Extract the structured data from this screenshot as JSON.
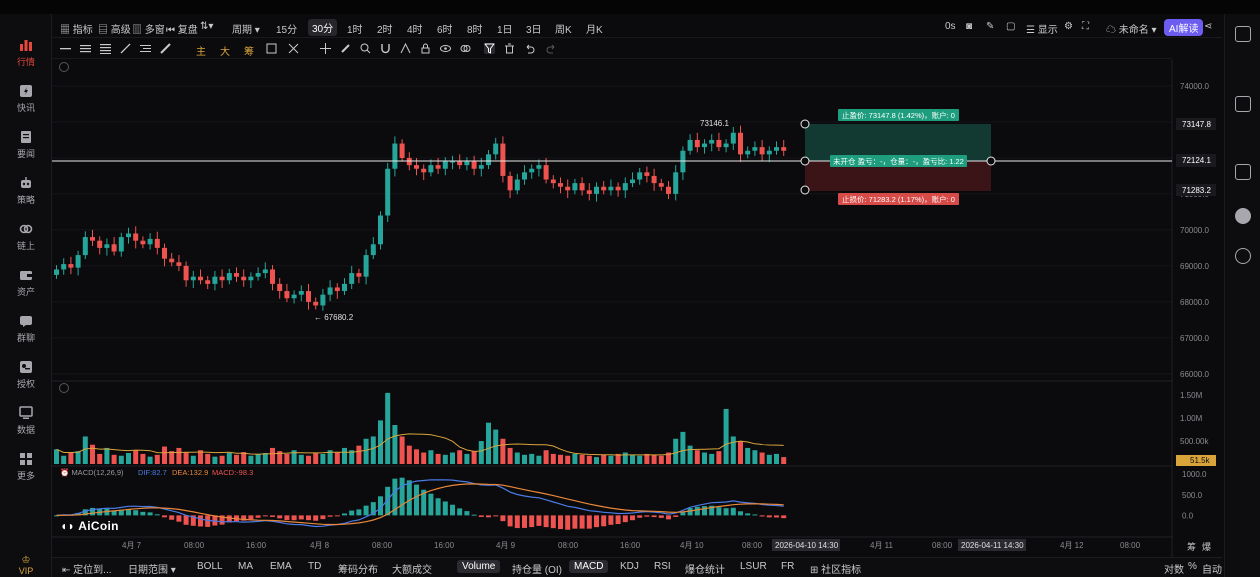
{
  "toolbar_top": {
    "indicators": "指标",
    "advanced": "高级",
    "multi": "多窗",
    "replay": "复盘",
    "period": "周期",
    "intervals": [
      "15分",
      "30分",
      "1时",
      "2时",
      "4时",
      "6时",
      "8时",
      "1日",
      "3日",
      "周K",
      "月K"
    ],
    "active_interval": "30分",
    "latency": "0s",
    "display": "显示",
    "layout_name": "未命名",
    "ai_label": "AI解读"
  },
  "toolbar_draw": {
    "main": "主",
    "big": "大",
    "chip": "筹"
  },
  "left_nav": [
    "行情",
    "快讯",
    "要闻",
    "策略",
    "链上",
    "资产",
    "群聊",
    "授权",
    "数据",
    "更多"
  ],
  "vip": "VIP",
  "price_axis": [
    "74000.0",
    "73000.0",
    "72000.0",
    "71000.0",
    "70000.0",
    "69000.0",
    "68000.0",
    "67000.0",
    "66000.0"
  ],
  "price_tags": {
    "take_profit": "73147.8",
    "current": "72124.1",
    "stop_loss": "71283.2"
  },
  "annotations": {
    "high": "73146.1",
    "low": "← 67680.2"
  },
  "order_box": {
    "tp_text": "止盈价: 73147.8 (1.42%)，账户: 0",
    "pnl_text": "未开仓 盈亏：-，仓量：-，盈亏比: 1.22",
    "sl_text": "止损价: 71283.2 (1.17%)，账户: 0"
  },
  "volume_axis": [
    "1.50M",
    "1.00M",
    "500.00k"
  ],
  "volume_tag": "51.5k",
  "macd_label": "MACD(12,26,9)",
  "macd_values": {
    "dif": "DIF:82.7",
    "dea": "DEA:132.9",
    "macd": "MACD:-98.3"
  },
  "macd_axis": [
    "1000.0",
    "500.0",
    "0.0"
  ],
  "time_axis": [
    "4月 7",
    "08:00",
    "16:00",
    "4月 8",
    "08:00",
    "16:00",
    "4月 9",
    "08:00",
    "16:00",
    "4月 10",
    "08:00",
    "4月 11",
    "08:00",
    "4月 12",
    "08:00"
  ],
  "time_tags": [
    "2026-04-10 14:30",
    "2026-04-11 14:30"
  ],
  "time_right": [
    "筹",
    "爆"
  ],
  "logo": "AiCoin",
  "bottom": {
    "locate": "定位到...",
    "date_range": "日期范围",
    "items": [
      "BOLL",
      "MA",
      "EMA",
      "TD",
      "筹码分布",
      "大额成交",
      "Volume",
      "持仓量 (OI)",
      "MACD",
      "KDJ",
      "RSI",
      "爆仓统计",
      "LSUR",
      "FR",
      "社区指标"
    ],
    "selected": [
      "Volume",
      "MACD"
    ],
    "right": [
      "对数",
      "%",
      "自动"
    ]
  },
  "colors": {
    "up": "#26a69a",
    "down": "#ef5350",
    "accent": "#6d5cf0",
    "bg": "#0b0b0d"
  },
  "chart_data": {
    "type": "candlestick",
    "price_range": [
      65800,
      74500
    ],
    "closes": [
      68900,
      69050,
      68950,
      69300,
      69800,
      69700,
      69500,
      69600,
      69400,
      69800,
      69900,
      69700,
      69600,
      69750,
      69500,
      69200,
      69100,
      69000,
      68600,
      68700,
      68600,
      68500,
      68700,
      68600,
      68800,
      68700,
      68600,
      68700,
      68800,
      68900,
      68500,
      68300,
      68100,
      68200,
      68300,
      68000,
      67900,
      68200,
      68400,
      68300,
      68500,
      68800,
      68700,
      69300,
      69600,
      70400,
      71700,
      72400,
      72000,
      71800,
      71700,
      71600,
      71800,
      71700,
      71900,
      71900,
      71800,
      71900,
      71700,
      71800,
      72100,
      72400,
      71500,
      71100,
      71400,
      71600,
      71700,
      71800,
      71400,
      71300,
      71200,
      71100,
      71300,
      71100,
      71000,
      71200,
      71100,
      71200,
      71100,
      71300,
      71400,
      71600,
      71500,
      71300,
      71200,
      71000,
      71600,
      72200,
      72500,
      72300,
      72400,
      72500,
      72300,
      72400,
      72700,
      72100,
      72200,
      72300,
      72100,
      72200,
      72300,
      72200
    ],
    "volumes": [
      0.32,
      0.18,
      0.25,
      0.28,
      0.6,
      0.42,
      0.22,
      0.35,
      0.2,
      0.18,
      0.24,
      0.3,
      0.22,
      0.16,
      0.2,
      0.38,
      0.28,
      0.35,
      0.25,
      0.18,
      0.3,
      0.22,
      0.16,
      0.18,
      0.24,
      0.2,
      0.26,
      0.18,
      0.22,
      0.24,
      0.35,
      0.28,
      0.22,
      0.3,
      0.2,
      0.18,
      0.25,
      0.22,
      0.3,
      0.25,
      0.35,
      0.3,
      0.4,
      0.55,
      0.6,
      0.95,
      1.55,
      0.85,
      0.6,
      0.4,
      0.32,
      0.25,
      0.3,
      0.22,
      0.2,
      0.25,
      0.3,
      0.22,
      0.28,
      0.5,
      0.9,
      0.75,
      0.55,
      0.35,
      0.25,
      0.2,
      0.22,
      0.18,
      0.3,
      0.22,
      0.2,
      0.18,
      0.22,
      0.2,
      0.18,
      0.15,
      0.2,
      0.18,
      0.22,
      0.25,
      0.2,
      0.18,
      0.22,
      0.2,
      0.18,
      0.25,
      0.55,
      0.7,
      0.4,
      0.3,
      0.25,
      0.22,
      0.28,
      1.2,
      0.6,
      0.5,
      0.35,
      0.3,
      0.25,
      0.2,
      0.22,
      0.15
    ],
    "volume_range": [
      0,
      1.7
    ],
    "macd_range": [
      -500,
      1100
    ]
  }
}
